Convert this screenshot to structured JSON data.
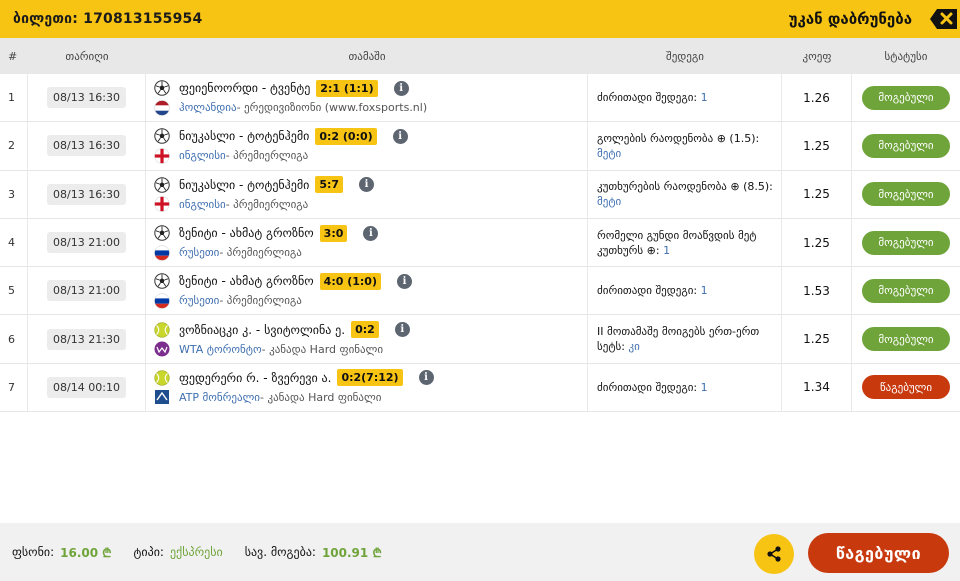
{
  "header": {
    "ticket_label": "ბილეთი: 170813155954",
    "back_label": "უკან დაბრუნება"
  },
  "columns": {
    "num": "#",
    "date": "თარიღი",
    "game": "თამაში",
    "bet": "შედეგი",
    "odds": "კოეფ",
    "status": "სტატუსი"
  },
  "rows": [
    {
      "num": "1",
      "date": "08/13 16:30",
      "sport": "soccer-ball-icon",
      "match": "ფეიენოორდი - ტვენტე",
      "score": "2:1 (1:1)",
      "flag": "netherlands-flag-icon",
      "country": "ჰოლანდია",
      "league": " - ერედივიზიონი (www.foxsports.nl)",
      "bet_text": "ძირითადი შედეგი:",
      "bet_value": "1",
      "odds": "1.26",
      "status": "მოგებული",
      "status_type": "won"
    },
    {
      "num": "2",
      "date": "08/13 16:30",
      "sport": "soccer-ball-icon",
      "match": "ნიუკასლი - ტოტენჰემი",
      "score": "0:2 (0:0)",
      "flag": "england-flag-icon",
      "country": "ინგლისი",
      "league": " - პრემიერლიგა",
      "bet_text": "გოლების რაოდენობა ⊕ (1.5):",
      "bet_value": "მეტი",
      "odds": "1.25",
      "status": "მოგებული",
      "status_type": "won"
    },
    {
      "num": "3",
      "date": "08/13 16:30",
      "sport": "soccer-ball-icon",
      "match": "ნიუკასლი - ტოტენჰემი",
      "score": "5:7",
      "flag": "england-flag-icon",
      "country": "ინგლისი",
      "league": " - პრემიერლიგა",
      "bet_text": "კუთხურების რაოდენობა ⊕ (8.5):",
      "bet_value": "მეტი",
      "odds": "1.25",
      "status": "მოგებული",
      "status_type": "won"
    },
    {
      "num": "4",
      "date": "08/13 21:00",
      "sport": "soccer-ball-icon",
      "match": "ზენიტი - ახმატ გროზნო",
      "score": "3:0",
      "flag": "russia-flag-icon",
      "country": "რუსეთი",
      "league": " - პრემიერლიგა",
      "bet_text": "რომელი გუნდი მოაწვდის მეტ კუთხურს ⊕:",
      "bet_value": "1",
      "odds": "1.25",
      "status": "მოგებული",
      "status_type": "won"
    },
    {
      "num": "5",
      "date": "08/13 21:00",
      "sport": "soccer-ball-icon",
      "match": "ზენიტი - ახმატ გროზნო",
      "score": "4:0 (1:0)",
      "flag": "russia-flag-icon",
      "country": "რუსეთი",
      "league": " - პრემიერლიგა",
      "bet_text": "ძირითადი შედეგი:",
      "bet_value": "1",
      "odds": "1.53",
      "status": "მოგებული",
      "status_type": "won"
    },
    {
      "num": "6",
      "date": "08/13 21:30",
      "sport": "tennis-ball-icon",
      "match": "ვოზნიაცკი კ. - სვიტოლინა ე.",
      "score": "0:2",
      "flag": "wta-logo-icon",
      "country": "WTA ტორონტო",
      "league": " - კანადა Hard ფინალი",
      "bet_text": "II მოთამაშე მოიგებს ერთ-ერთ სეტს:",
      "bet_value": "კი",
      "odds": "1.25",
      "status": "მოგებული",
      "status_type": "won"
    },
    {
      "num": "7",
      "date": "08/14 00:10",
      "sport": "tennis-ball-icon",
      "match": "ფედერერი რ. - ზვერევი ა.",
      "score": "0:2(7:12)",
      "flag": "atp-logo-icon",
      "country": "ATP მონრეალი",
      "league": " - კანადა Hard ფინალი",
      "bet_text": "ძირითადი შედეგი:",
      "bet_value": "1",
      "odds": "1.34",
      "status": "წაგებული",
      "status_type": "lost"
    }
  ],
  "footer": {
    "stake_label": "ფსონი:",
    "stake_value": "16.00 ₾",
    "type_label": "ტიპი:",
    "type_value": "ექსპრესი",
    "win_label": "სავ. მოგება:",
    "win_value": "100.91 ₾",
    "result_label": "წაგებული"
  },
  "colors": {
    "accent": "#f8c414",
    "won": "#6fa43a",
    "lost": "#c8390e"
  }
}
